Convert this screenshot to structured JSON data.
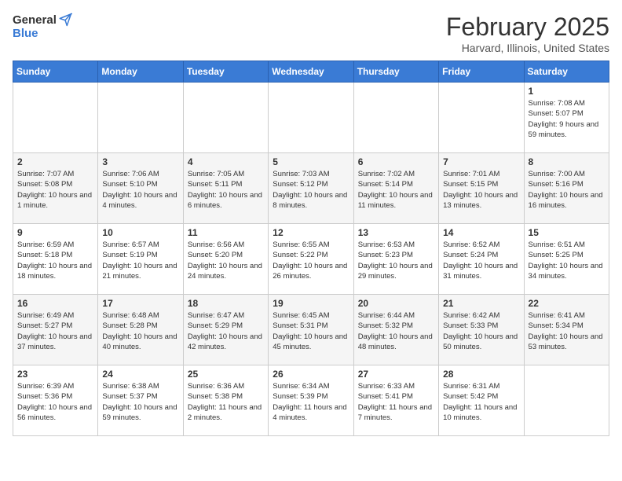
{
  "header": {
    "logo_general": "General",
    "logo_blue": "Blue",
    "title": "February 2025",
    "subtitle": "Harvard, Illinois, United States"
  },
  "weekdays": [
    "Sunday",
    "Monday",
    "Tuesday",
    "Wednesday",
    "Thursday",
    "Friday",
    "Saturday"
  ],
  "weeks": [
    [
      {
        "day": "",
        "info": ""
      },
      {
        "day": "",
        "info": ""
      },
      {
        "day": "",
        "info": ""
      },
      {
        "day": "",
        "info": ""
      },
      {
        "day": "",
        "info": ""
      },
      {
        "day": "",
        "info": ""
      },
      {
        "day": "1",
        "info": "Sunrise: 7:08 AM\nSunset: 5:07 PM\nDaylight: 9 hours and 59 minutes."
      }
    ],
    [
      {
        "day": "2",
        "info": "Sunrise: 7:07 AM\nSunset: 5:08 PM\nDaylight: 10 hours and 1 minute."
      },
      {
        "day": "3",
        "info": "Sunrise: 7:06 AM\nSunset: 5:10 PM\nDaylight: 10 hours and 4 minutes."
      },
      {
        "day": "4",
        "info": "Sunrise: 7:05 AM\nSunset: 5:11 PM\nDaylight: 10 hours and 6 minutes."
      },
      {
        "day": "5",
        "info": "Sunrise: 7:03 AM\nSunset: 5:12 PM\nDaylight: 10 hours and 8 minutes."
      },
      {
        "day": "6",
        "info": "Sunrise: 7:02 AM\nSunset: 5:14 PM\nDaylight: 10 hours and 11 minutes."
      },
      {
        "day": "7",
        "info": "Sunrise: 7:01 AM\nSunset: 5:15 PM\nDaylight: 10 hours and 13 minutes."
      },
      {
        "day": "8",
        "info": "Sunrise: 7:00 AM\nSunset: 5:16 PM\nDaylight: 10 hours and 16 minutes."
      }
    ],
    [
      {
        "day": "9",
        "info": "Sunrise: 6:59 AM\nSunset: 5:18 PM\nDaylight: 10 hours and 18 minutes."
      },
      {
        "day": "10",
        "info": "Sunrise: 6:57 AM\nSunset: 5:19 PM\nDaylight: 10 hours and 21 minutes."
      },
      {
        "day": "11",
        "info": "Sunrise: 6:56 AM\nSunset: 5:20 PM\nDaylight: 10 hours and 24 minutes."
      },
      {
        "day": "12",
        "info": "Sunrise: 6:55 AM\nSunset: 5:22 PM\nDaylight: 10 hours and 26 minutes."
      },
      {
        "day": "13",
        "info": "Sunrise: 6:53 AM\nSunset: 5:23 PM\nDaylight: 10 hours and 29 minutes."
      },
      {
        "day": "14",
        "info": "Sunrise: 6:52 AM\nSunset: 5:24 PM\nDaylight: 10 hours and 31 minutes."
      },
      {
        "day": "15",
        "info": "Sunrise: 6:51 AM\nSunset: 5:25 PM\nDaylight: 10 hours and 34 minutes."
      }
    ],
    [
      {
        "day": "16",
        "info": "Sunrise: 6:49 AM\nSunset: 5:27 PM\nDaylight: 10 hours and 37 minutes."
      },
      {
        "day": "17",
        "info": "Sunrise: 6:48 AM\nSunset: 5:28 PM\nDaylight: 10 hours and 40 minutes."
      },
      {
        "day": "18",
        "info": "Sunrise: 6:47 AM\nSunset: 5:29 PM\nDaylight: 10 hours and 42 minutes."
      },
      {
        "day": "19",
        "info": "Sunrise: 6:45 AM\nSunset: 5:31 PM\nDaylight: 10 hours and 45 minutes."
      },
      {
        "day": "20",
        "info": "Sunrise: 6:44 AM\nSunset: 5:32 PM\nDaylight: 10 hours and 48 minutes."
      },
      {
        "day": "21",
        "info": "Sunrise: 6:42 AM\nSunset: 5:33 PM\nDaylight: 10 hours and 50 minutes."
      },
      {
        "day": "22",
        "info": "Sunrise: 6:41 AM\nSunset: 5:34 PM\nDaylight: 10 hours and 53 minutes."
      }
    ],
    [
      {
        "day": "23",
        "info": "Sunrise: 6:39 AM\nSunset: 5:36 PM\nDaylight: 10 hours and 56 minutes."
      },
      {
        "day": "24",
        "info": "Sunrise: 6:38 AM\nSunset: 5:37 PM\nDaylight: 10 hours and 59 minutes."
      },
      {
        "day": "25",
        "info": "Sunrise: 6:36 AM\nSunset: 5:38 PM\nDaylight: 11 hours and 2 minutes."
      },
      {
        "day": "26",
        "info": "Sunrise: 6:34 AM\nSunset: 5:39 PM\nDaylight: 11 hours and 4 minutes."
      },
      {
        "day": "27",
        "info": "Sunrise: 6:33 AM\nSunset: 5:41 PM\nDaylight: 11 hours and 7 minutes."
      },
      {
        "day": "28",
        "info": "Sunrise: 6:31 AM\nSunset: 5:42 PM\nDaylight: 11 hours and 10 minutes."
      },
      {
        "day": "",
        "info": ""
      }
    ]
  ]
}
